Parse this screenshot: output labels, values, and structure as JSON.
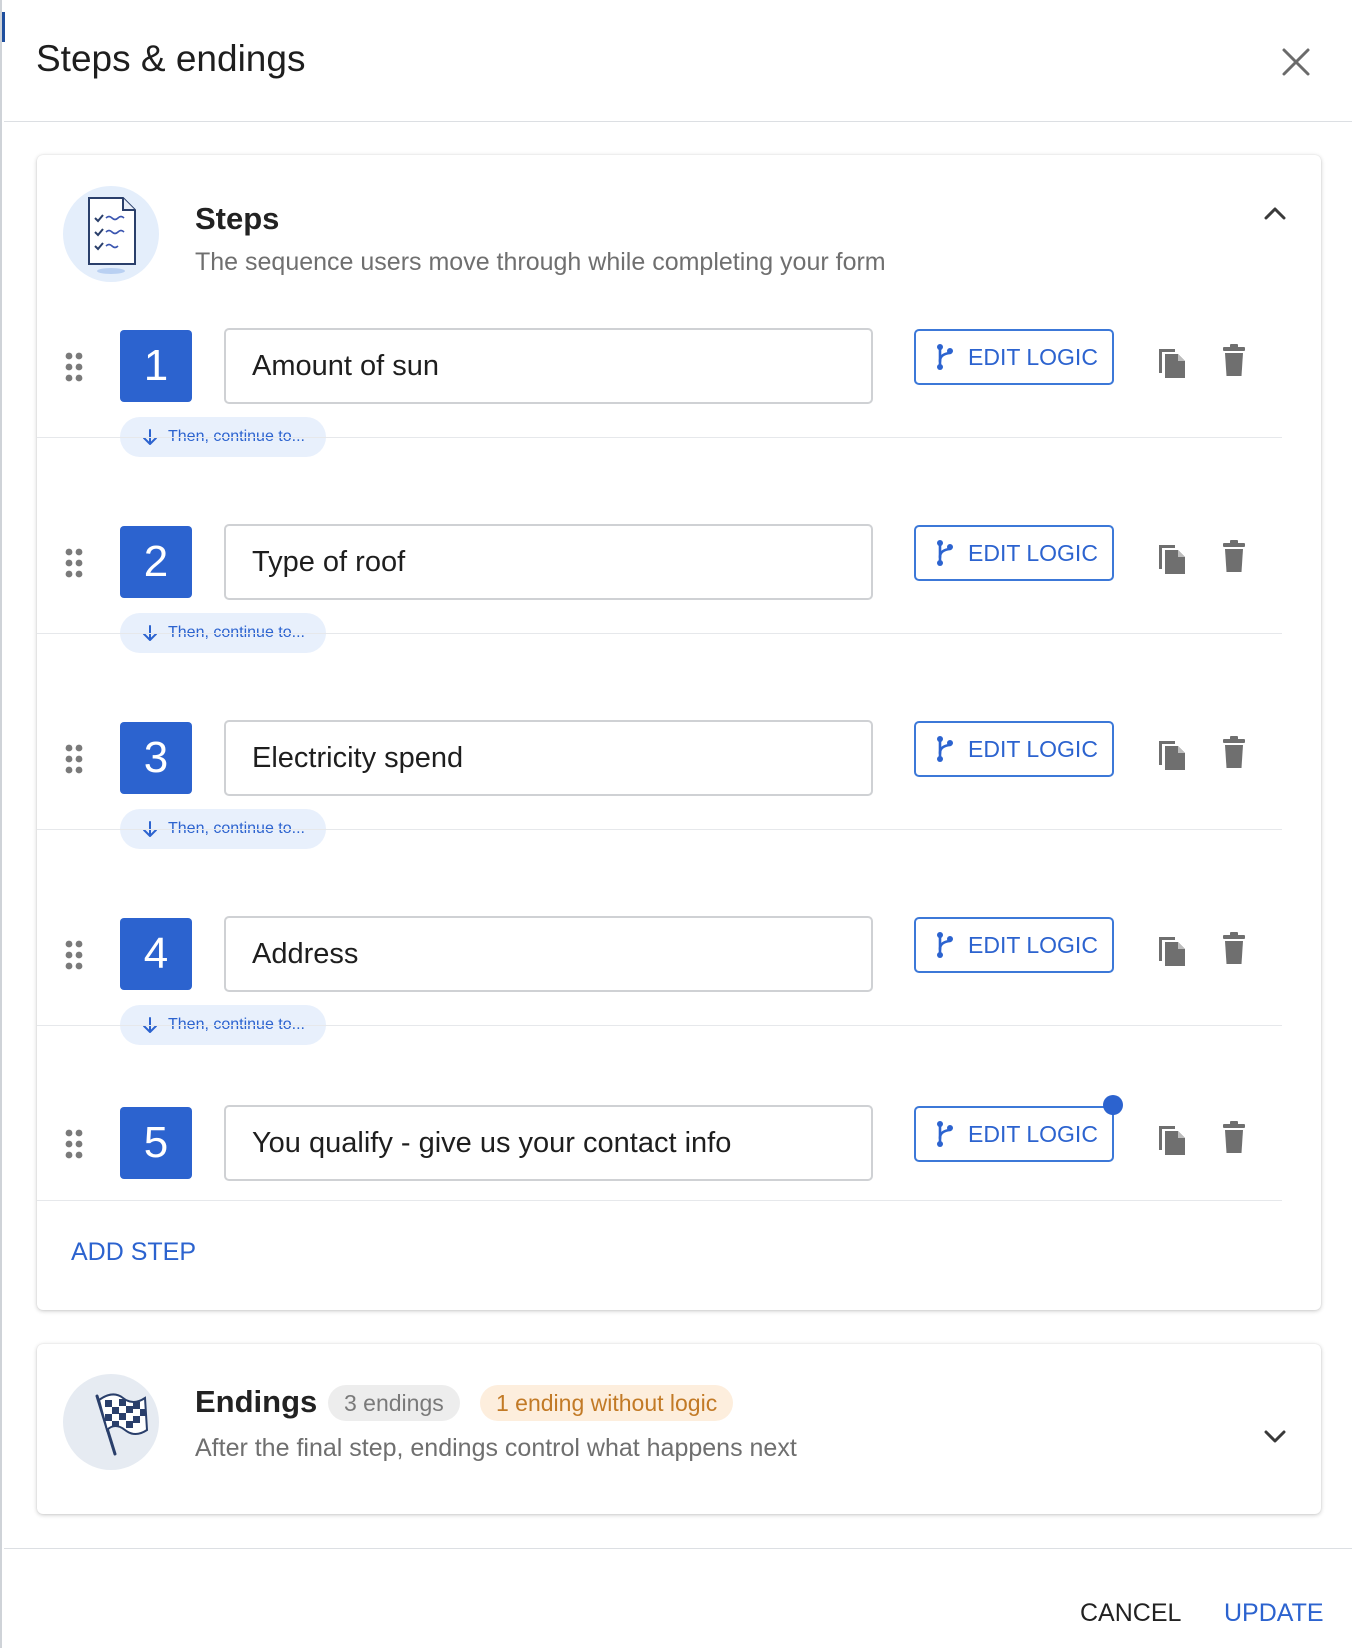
{
  "dialog": {
    "title": "Steps & endings",
    "close_icon": "close-icon"
  },
  "steps_section": {
    "title": "Steps",
    "subtitle": "The sequence users move through while completing your form",
    "illustration_icon": "checklist-document-icon",
    "collapse_icon": "chevron-up-icon",
    "edit_logic_label": "EDIT LOGIC",
    "continue_label": "Then, continue to...",
    "add_step_label": "ADD STEP",
    "items": [
      {
        "number": "1",
        "name": "Amount of sun"
      },
      {
        "number": "2",
        "name": "Type of roof"
      },
      {
        "number": "3",
        "name": "Electricity spend"
      },
      {
        "number": "4",
        "name": "Address"
      },
      {
        "number": "5",
        "name": "You qualify - give us your contact info"
      }
    ]
  },
  "endings_section": {
    "title": "Endings",
    "count_badge": "3 endings",
    "warning_badge": "1 ending without logic",
    "subtitle": "After the final step, endings control what happens next",
    "illustration_icon": "checkered-flag-icon",
    "expand_icon": "chevron-down-icon"
  },
  "footer": {
    "cancel_label": "CANCEL",
    "update_label": "UPDATE"
  },
  "colors": {
    "accent": "#2c63cf",
    "warning_text": "#c27a26",
    "warning_bg": "#fdeedd"
  }
}
